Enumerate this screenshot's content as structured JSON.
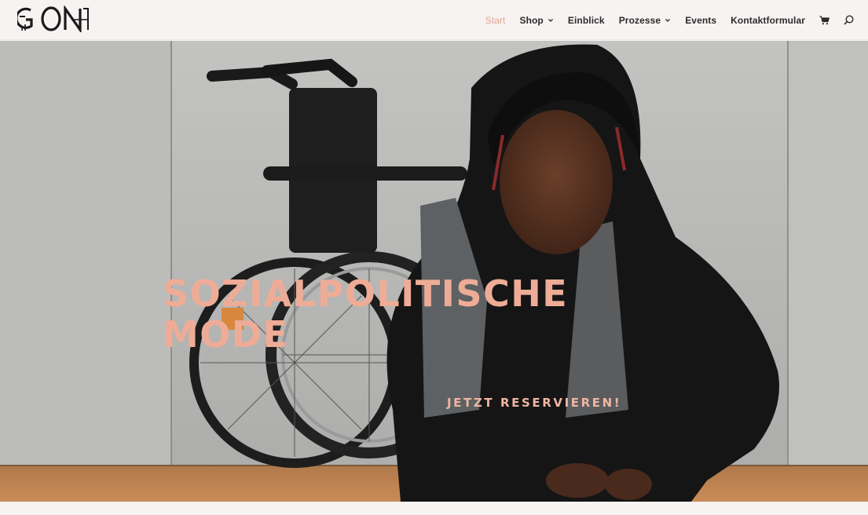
{
  "brand": {
    "logo_text": "GON",
    "accent_color": "#eeac97"
  },
  "nav": {
    "items": [
      {
        "label": "Start",
        "active": true,
        "has_dropdown": false
      },
      {
        "label": "Shop",
        "active": false,
        "has_dropdown": true
      },
      {
        "label": "Einblick",
        "active": false,
        "has_dropdown": false
      },
      {
        "label": "Prozesse",
        "active": false,
        "has_dropdown": true
      },
      {
        "label": "Events",
        "active": false,
        "has_dropdown": false
      },
      {
        "label": "Kontaktformular",
        "active": false,
        "has_dropdown": false
      }
    ],
    "cart_icon": "cart-icon",
    "search_icon": "search-icon"
  },
  "hero": {
    "title_line1": "SOZIALPOLITISCHE",
    "title_line2": "MODE",
    "cta_label": "JETZT RESERVIEREN!",
    "image_description_icon": "hero-photo"
  }
}
